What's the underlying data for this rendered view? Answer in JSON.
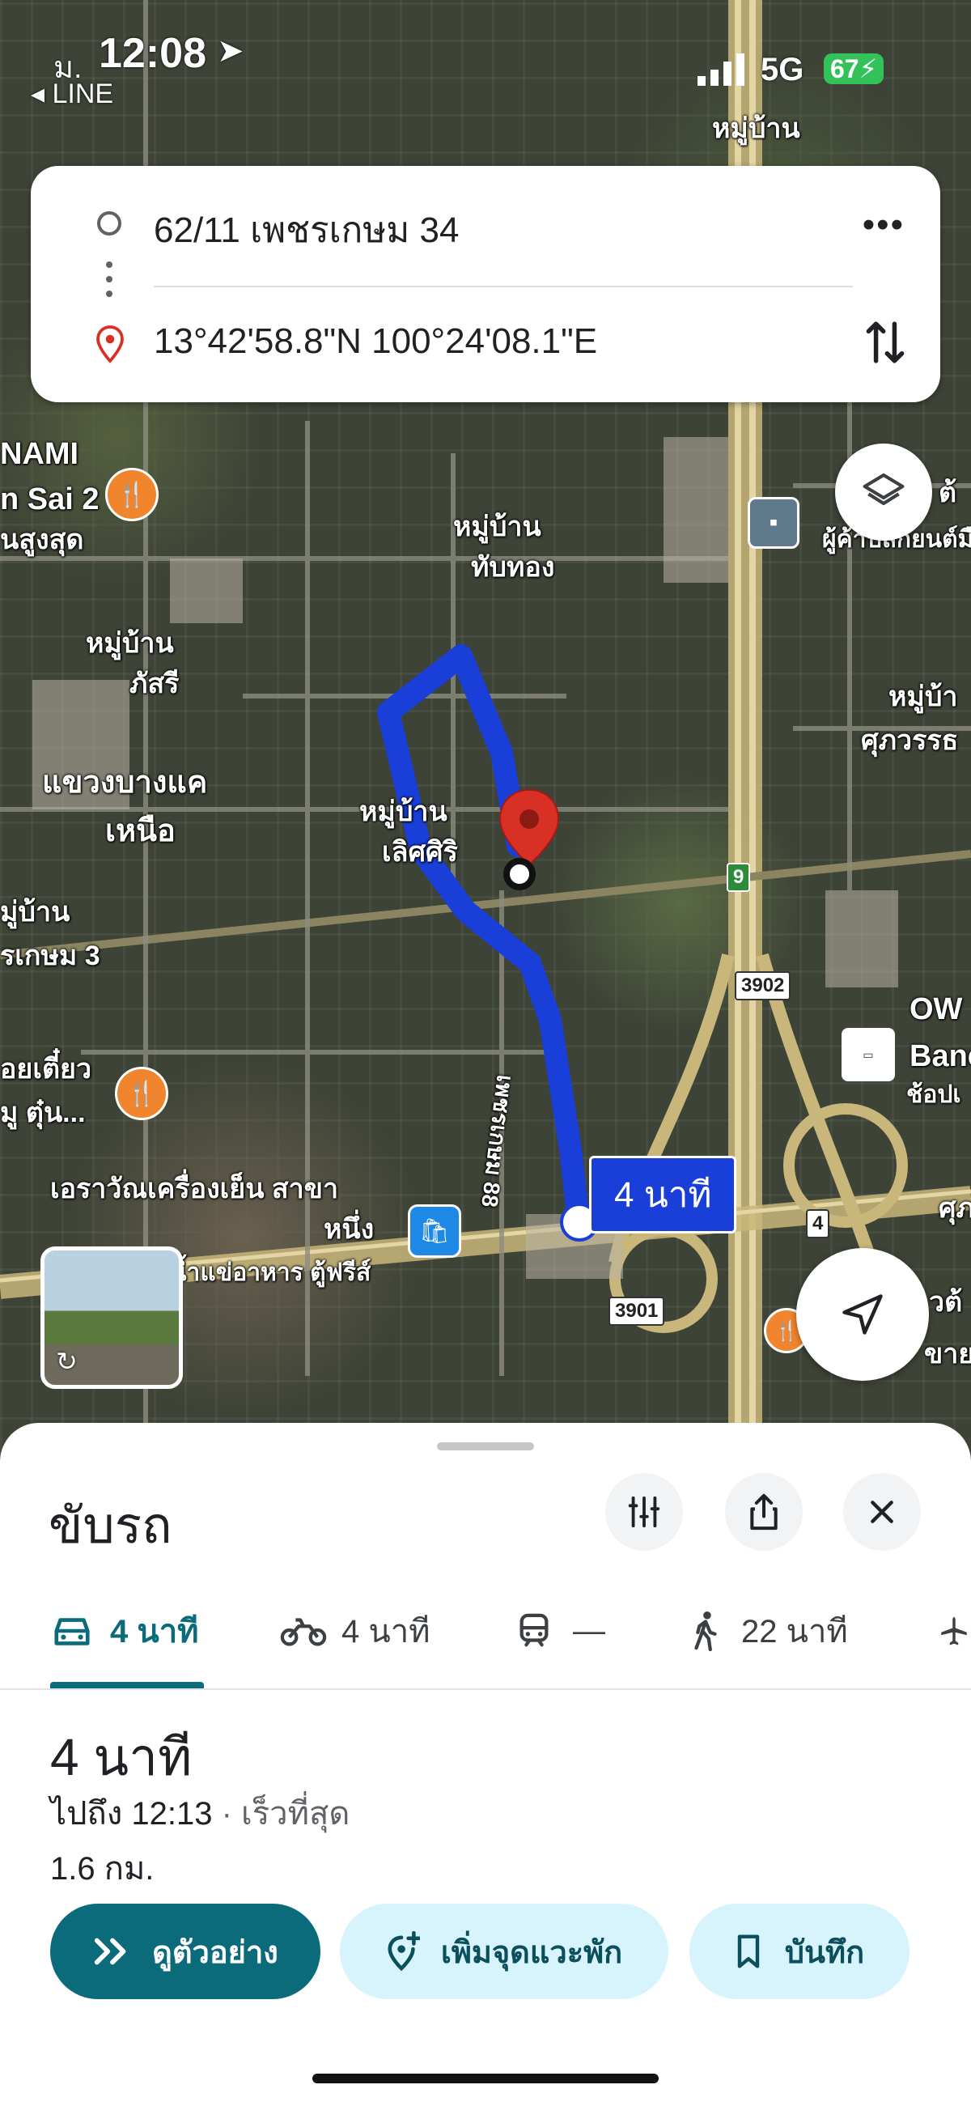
{
  "status_bar": {
    "date": "ม.",
    "time": "12:08",
    "back_app": "LINE",
    "network": "5G",
    "battery": "67"
  },
  "route_card": {
    "origin": "62/11 เพชรเกษม 34",
    "destination": "13°42'58.8\"N 100°24'08.1\"E"
  },
  "map": {
    "labels": {
      "nami": "NAMI",
      "sai2": "n Sai 2",
      "sung_sut": "นสูงสุด",
      "moo_ban_top": "หมู่บ้าน",
      "moo_ban_thapthong_1": "หมู่บ้าน",
      "moo_ban_thapthong_2": "ทับทอง",
      "moo_ban_phatsri_1": "หมู่บ้าน",
      "moo_ban_phatsri_2": "ภัสรี",
      "khwaeng_1": "แขวงบางแค",
      "khwaeng_2": "เหนือ",
      "moo_ban_lertsiri_1": "หมู่บ้าน",
      "moo_ban_lertsiri_2": "เลิศศิริ",
      "moo_ban_left_1": "มู่บ้าน",
      "moo_ban_left_2": "รเกษม 3",
      "noodle_1": "อยเตี๋ยว",
      "noodle_2": "มู ตุ๋น...",
      "erawan_1": "เอราวัณเครื่องเย็น สาขา",
      "erawan_2": "หนึ่ง",
      "buffet": "น้ำแข่อาหาร ตู้ฟรีส์",
      "right_top": "ผู้ค้าปลีกยนต์มื",
      "right_top_2": "ต้",
      "moo_ban_right_1": "หมู่บ้า",
      "moo_ban_right_2": "ศุภวรรธ",
      "ow_1": "OW",
      "ow_2": "Banc",
      "ow_3": "ช้อปเ",
      "road_name": "เพชรเกษม 88",
      "right_bottom_1": "วต้",
      "right_bottom_2": "ขาย",
      "right_mid": "ศุภ"
    },
    "shields": {
      "s9": "9",
      "s3902": "3902",
      "s3901": "3901",
      "s4": "4"
    },
    "duration_bubble": "4 นาที",
    "route_color": "#1a3fd9",
    "pin_color": "#d93025"
  },
  "sheet": {
    "title": "ขับรถ",
    "tabs": [
      {
        "icon": "car-icon",
        "label": "4 นาที",
        "selected": true
      },
      {
        "icon": "motorcycle-icon",
        "label": "4 นาที"
      },
      {
        "icon": "transit-icon",
        "label": "—"
      },
      {
        "icon": "walk-icon",
        "label": "22 นาที"
      }
    ],
    "duration": "4 นาที",
    "arrival": "ไปถึง 12:13",
    "fastest": "· เร็วที่สุด",
    "distance": "1.6 กม.",
    "actions": {
      "preview": "ดูตัวอย่าง",
      "add_stop": "เพิ่มจุดแวะพัก",
      "save": "บันทึก"
    },
    "accent_color": "#0b6b7a"
  }
}
